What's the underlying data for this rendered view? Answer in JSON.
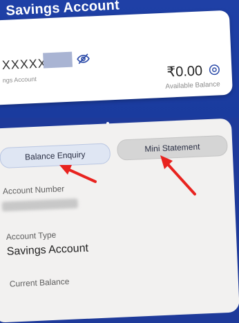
{
  "header": {
    "title": "Savings Account"
  },
  "balance_card": {
    "account_masked": "XXXXX",
    "account_sub": "ngs Account",
    "balance": "₹0.00",
    "balance_label": "Available Balance",
    "eye_icon": "eye-slash-icon",
    "refresh_icon": "refresh-icon"
  },
  "tabs": {
    "balance_enquiry": "Balance Enquiry",
    "mini_statement": "Mini Statement"
  },
  "details": {
    "account_number_label": "Account Number",
    "account_type_label": "Account Type",
    "account_type_value": "Savings Account",
    "current_balance_label": "Current Balance"
  },
  "colors": {
    "header_bg": "#1e3a9a",
    "arrow": "#e8231f",
    "card_bg": "#ffffff",
    "details_bg": "#f2f1f0"
  }
}
